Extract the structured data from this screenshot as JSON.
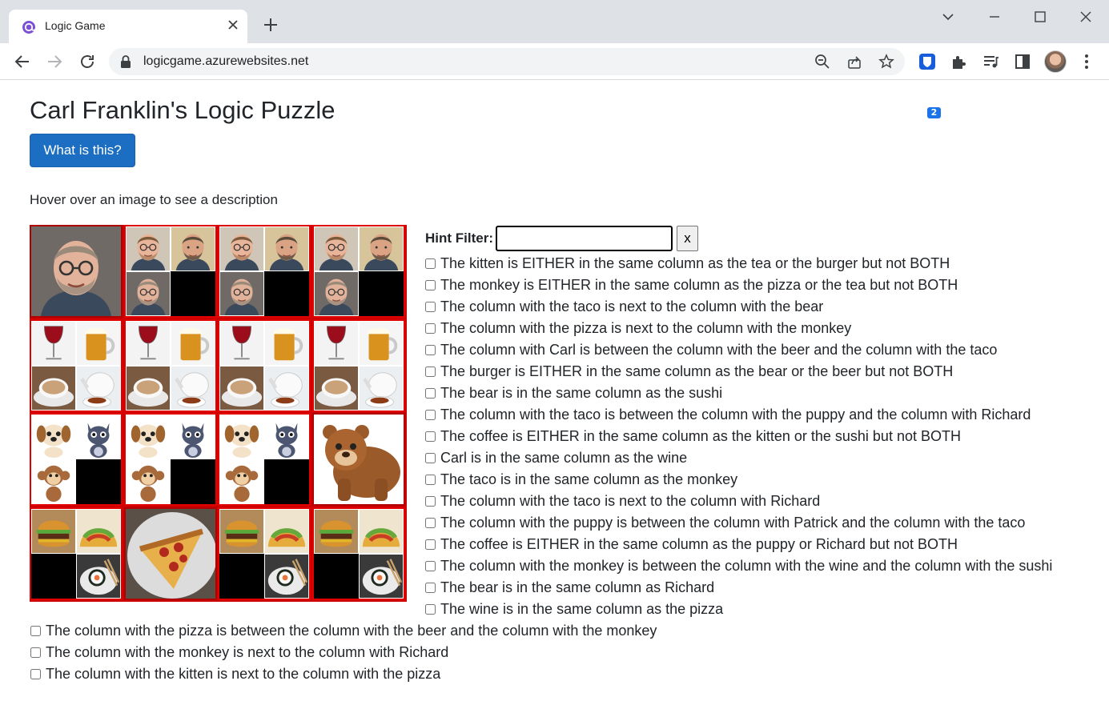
{
  "browser": {
    "tab_title": "Logic Game",
    "url": "logicgame.azurewebsites.net",
    "extension_badge": "2",
    "accent": "#1a73e8"
  },
  "page": {
    "title": "Carl Franklin's Logic Puzzle",
    "what_button": "What is this?",
    "hover_note": "Hover over an image to see a description",
    "hint_label": "Hint Filter:",
    "hint_value": "",
    "clear_label": "x",
    "button_color": "#1b6ec2",
    "grid_border_color": "#e00000"
  },
  "grid": {
    "rows": [
      {
        "category": "people",
        "cells": [
          {
            "solved": "Carl"
          },
          {
            "options": [
              "Patrick",
              "Richard",
              "Carl",
              null
            ]
          },
          {
            "options": [
              "Patrick",
              "Richard",
              "Carl",
              null
            ]
          },
          {
            "options": [
              "Patrick",
              "Richard",
              "Carl",
              null
            ]
          }
        ]
      },
      {
        "category": "drinks",
        "cells": [
          {
            "options": [
              "wine",
              "beer",
              "coffee",
              "tea"
            ]
          },
          {
            "options": [
              "wine",
              "beer",
              "coffee",
              "tea"
            ]
          },
          {
            "options": [
              "wine",
              "beer",
              "coffee",
              "tea"
            ]
          },
          {
            "options": [
              "wine",
              "beer",
              "coffee",
              "tea"
            ]
          }
        ]
      },
      {
        "category": "animals",
        "cells": [
          {
            "options": [
              "puppy",
              "kitten",
              "monkey",
              null
            ]
          },
          {
            "options": [
              "puppy",
              "kitten",
              "monkey",
              null
            ]
          },
          {
            "options": [
              "puppy",
              "kitten",
              "monkey",
              null
            ]
          },
          {
            "solved": "bear"
          }
        ]
      },
      {
        "category": "foods",
        "cells": [
          {
            "options": [
              "burger",
              "taco",
              null,
              "sushi"
            ]
          },
          {
            "solved": "pizza"
          },
          {
            "options": [
              "burger",
              "taco",
              null,
              "sushi"
            ]
          },
          {
            "options": [
              "burger",
              "taco",
              null,
              "sushi"
            ]
          }
        ]
      }
    ]
  },
  "clues": [
    "The kitten is EITHER in the same column as the tea or the burger but not BOTH",
    "The monkey is EITHER in the same column as the pizza or the tea but not BOTH",
    "The column with the taco is next to the column with the bear",
    "The column with the pizza is next to the column with the monkey",
    "The column with Carl is between the column with the beer and the column with the taco",
    "The burger is EITHER in the same column as the bear or the beer but not BOTH",
    "The bear is in the same column as the sushi",
    "The column with the taco is between the column with the puppy and the column with Richard",
    "The coffee is EITHER in the same column as the kitten or the sushi but not BOTH",
    "Carl is in the same column as the wine",
    "The taco is in the same column as the monkey",
    "The column with the taco is next to the column with Richard",
    "The column with the puppy is between the column with Patrick and the column with the taco",
    "The coffee is EITHER in the same column as the puppy or Richard but not BOTH",
    "The column with the monkey is between the column with the wine and the column with the sushi",
    "The bear is in the same column as Richard",
    "The wine is in the same column as the pizza",
    "The column with the pizza is between the column with the beer and the column with the monkey",
    "The column with the monkey is next to the column with Richard",
    "The column with the kitten is next to the column with the pizza"
  ]
}
